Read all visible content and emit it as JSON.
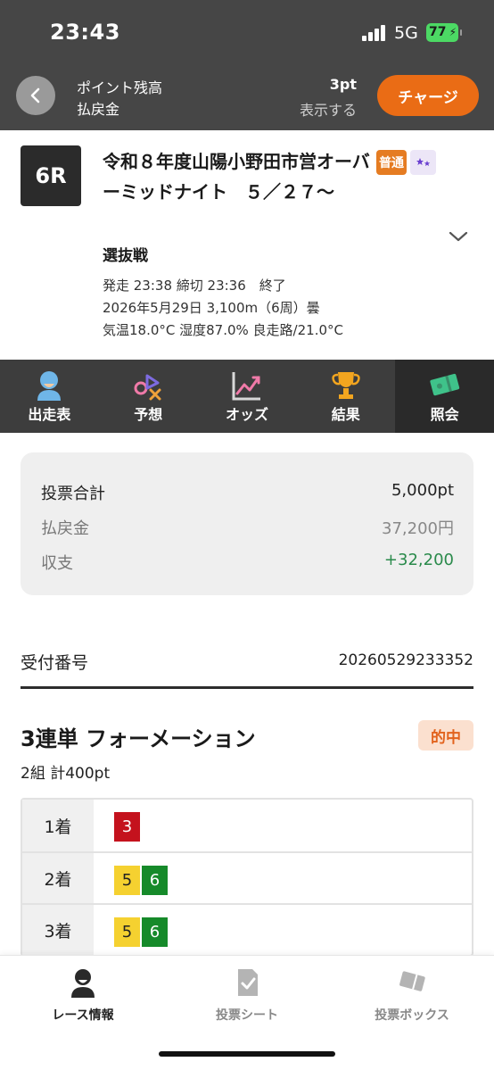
{
  "status": {
    "time": "23:43",
    "network": "5G",
    "battery": "77"
  },
  "header": {
    "points_label": "ポイント残高",
    "points_value": "3pt",
    "refund_label": "払戻金",
    "show_label": "表示する",
    "charge_label": "チャージ"
  },
  "race": {
    "number": "6R",
    "title": "令和８年度山陽小野田市営オーバーミッドナイト　５／２７〜",
    "tag_normal": "普通",
    "class": "選抜戦",
    "meta_line1": "発走 23:38 締切 23:36　終了",
    "meta_line2": "2026年5月29日 3,100m（6周）曇",
    "meta_line3": "気温18.0°C 湿度87.0% 良走路/21.0°C"
  },
  "tabs": [
    {
      "label": "出走表",
      "icon": "racer-icon"
    },
    {
      "label": "予想",
      "icon": "prediction-icon"
    },
    {
      "label": "オッズ",
      "icon": "odds-chart-icon"
    },
    {
      "label": "結果",
      "icon": "trophy-icon"
    },
    {
      "label": "照会",
      "icon": "ticket-icon"
    }
  ],
  "summary": {
    "total_label": "投票合計",
    "total_value": "5,000pt",
    "refund_label": "払戻金",
    "refund_value": "37,200円",
    "balance_label": "収支",
    "balance_value": "+32,200"
  },
  "receipt": {
    "label": "受付番号",
    "value": "20260529233352"
  },
  "bet": {
    "type": "3連単 フォーメーション",
    "result": "的中",
    "count": "2組 計400pt",
    "places": [
      {
        "label": "1着",
        "numbers": [
          "3"
        ]
      },
      {
        "label": "2着",
        "numbers": [
          "5",
          "6"
        ]
      },
      {
        "label": "3着",
        "numbers": [
          "5",
          "6"
        ]
      }
    ]
  },
  "bottom_nav": [
    {
      "label": "レース情報",
      "icon": "racer-icon"
    },
    {
      "label": "投票シート",
      "icon": "check-sheet-icon"
    },
    {
      "label": "投票ボックス",
      "icon": "ticket-box-icon"
    }
  ],
  "colors": {
    "accent": "#ea6c15",
    "positive": "#2a8a4b",
    "bike_3": "#c4121d",
    "bike_5": "#f5d130",
    "bike_6": "#168a2a"
  }
}
